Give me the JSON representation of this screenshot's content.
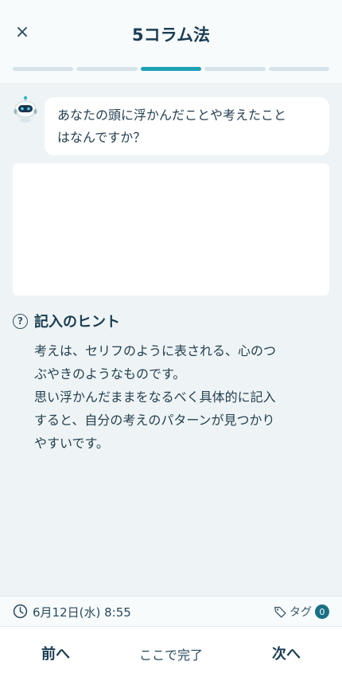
{
  "header": {
    "close_label": "×",
    "title": "5コラム法",
    "progress": {
      "total_steps": 5,
      "current_step": 3
    }
  },
  "prompt": {
    "avatar_icon": "robot-icon",
    "question_line1": "あなたの頭に浮かんだことや考えたこと",
    "question_line2": "はなんですか？"
  },
  "answer": {
    "value": "",
    "placeholder": ""
  },
  "hint": {
    "icon": "question-circle-icon",
    "title": "記入のヒント",
    "line1": "考えは、セリフのように表される、心のつ",
    "line2": "ぶやきのようなものです。",
    "line3": "思い浮かんだままをなるべく具体的に記入",
    "line4": "すると、自分の考えのパターンが見つかり",
    "line5": "やすいです。"
  },
  "meta": {
    "date_icon": "clock-icon",
    "datetime": "6月12日(水) 8:55",
    "tag_icon": "tag-icon",
    "tag_label": "タグ",
    "tag_count": "0"
  },
  "footer": {
    "prev_label": "前へ",
    "done_label": "ここで完了",
    "next_label": "次へ"
  },
  "colors": {
    "accent": "#1ba0b4",
    "background": "#eef4f5",
    "text": "#1f3f52",
    "badge": "#1a6f85"
  }
}
